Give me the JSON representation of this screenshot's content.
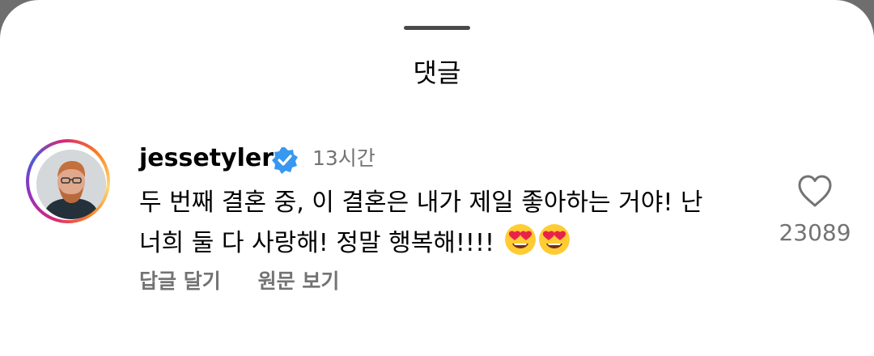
{
  "sheet": {
    "title": "댓글"
  },
  "comment": {
    "username": "jessetyler",
    "time": "13시간",
    "text": "두 번째 결혼 중, 이 결혼은 내가 제일 좋아하는 거야! 난\n너희 둘 다 사랑해! 정말 행복해!!!! ",
    "emojis": [
      "heart-eyes-emoji",
      "heart-eyes-emoji"
    ],
    "actions": {
      "reply": "답글 달기",
      "see_translation": "원문 보기"
    },
    "likes": "23089"
  },
  "colors": {
    "secondary_text": "#737373",
    "verified_blue": "#3897f0"
  }
}
